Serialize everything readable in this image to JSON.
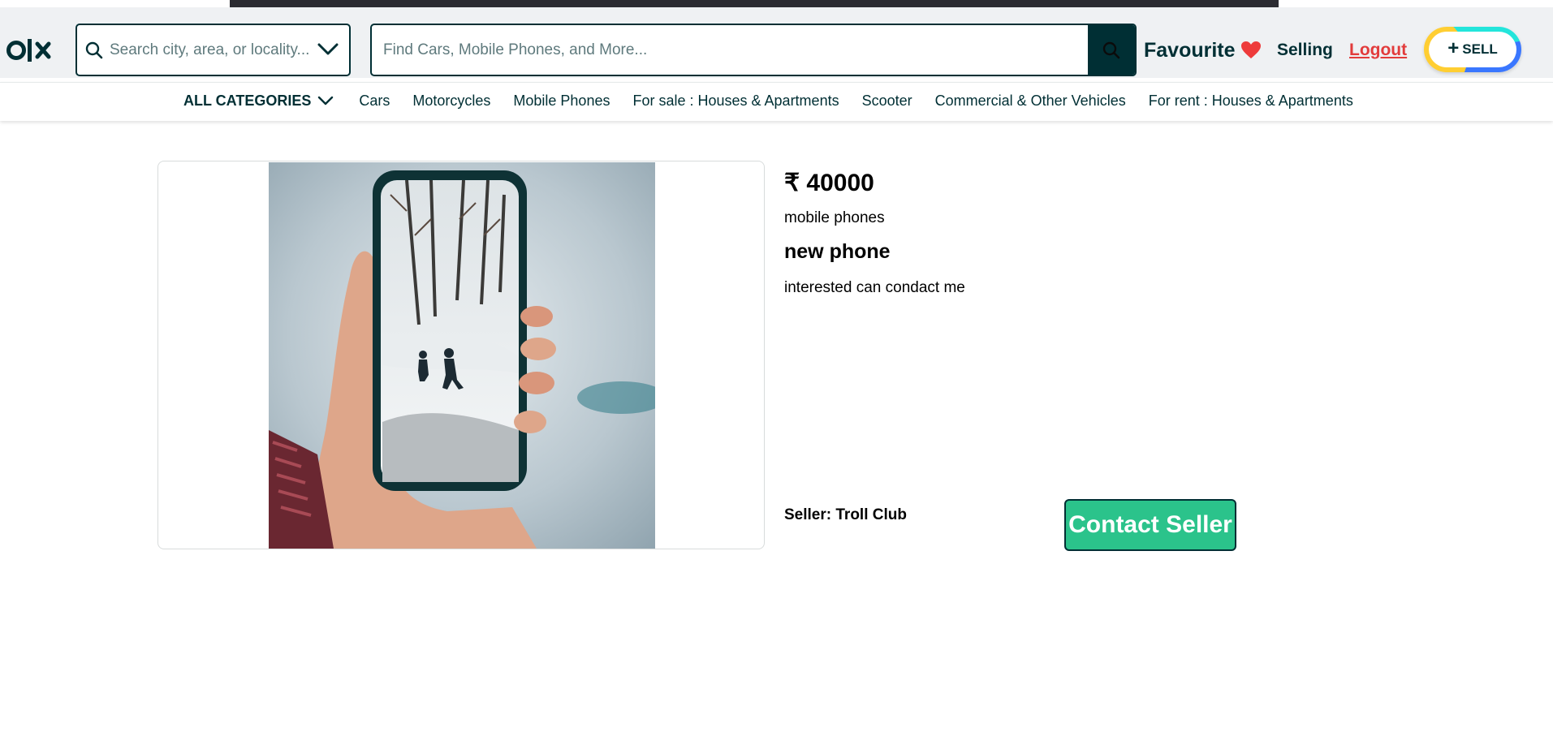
{
  "header": {
    "logo_text": "olx",
    "location_search": {
      "placeholder": "Search city, area, or locality...",
      "value": ""
    },
    "main_search": {
      "placeholder": "Find Cars, Mobile Phones, and More...",
      "value": ""
    },
    "favourite_label": "Favourite",
    "selling_label": "Selling",
    "logout_label": "Logout",
    "sell_label": "SELL"
  },
  "categories": {
    "all_label": "ALL CATEGORIES",
    "items": [
      "Cars",
      "Motorcycles",
      "Mobile Phones",
      "For sale : Houses & Apartments",
      "Scooter",
      "Commercial & Other Vehicles",
      "For rent : Houses & Apartments"
    ]
  },
  "product": {
    "price": "₹ 40000",
    "category": "mobile phones",
    "title": "new phone",
    "description": "interested can condact me",
    "seller": "Seller: Troll Club",
    "contact_label": "Contact Seller",
    "image_alt": "hand holding phone in snow"
  },
  "colors": {
    "brand_dark": "#002f34",
    "logout_red": "#e23b3b",
    "contact_green": "#2bc38b",
    "heart_red": "#ee3b3b"
  }
}
